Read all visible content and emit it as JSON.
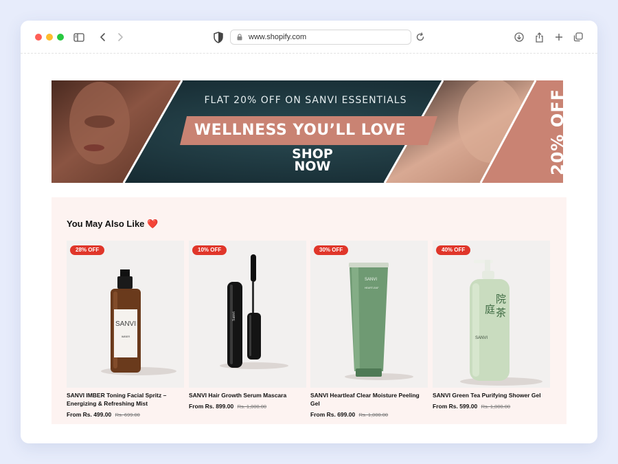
{
  "browser": {
    "url": "www.shopify.com",
    "icons": [
      "sidebar-icon",
      "back-icon",
      "forward-icon",
      "shield-icon",
      "lock-icon",
      "reload-icon",
      "download-icon",
      "share-icon",
      "new-tab-icon",
      "tabs-icon"
    ]
  },
  "banner": {
    "subtitle": "FLAT 20% OFF ON SANVI ESSENTIALS",
    "headline": "WELLNESS YOU’LL LOVE",
    "cta_line1": "SHOP",
    "cta_line2": "NOW",
    "side_text": "20% OFF",
    "colors": {
      "dark": "#1d3b44",
      "accent": "#c98373"
    }
  },
  "recommendations": {
    "title": "You May Also Like",
    "title_icon": "heart-emoji",
    "title_glyph": "❤️",
    "products": [
      {
        "badge": "28% OFF",
        "name": "SANVI IMBER Toning Facial Spritz – Energizing & Refreshing Mist",
        "price": "From Rs. 499.00",
        "compare_price": "Rs. 699.00",
        "image": "amber-spray-bottle"
      },
      {
        "badge": "10% OFF",
        "name": "SANVI Hair Growth Serum Mascara",
        "price": "From Rs. 899.00",
        "compare_price": "Rs. 1,000.00",
        "image": "mascara"
      },
      {
        "badge": "30% OFF",
        "name": "SANVI Heartleaf Clear Moisture Peeling Gel",
        "price": "From Rs. 699.00",
        "compare_price": "Rs. 1,000.00",
        "image": "green-tube"
      },
      {
        "badge": "40% OFF",
        "name": "SANVI Green Tea Purifying Shower Gel",
        "price": "From Rs. 599.00",
        "compare_price": "Rs. 1,000.00",
        "image": "pump-bottle"
      }
    ],
    "colors": {
      "badge": "#e0362a",
      "background": "#fdf3f1"
    }
  }
}
